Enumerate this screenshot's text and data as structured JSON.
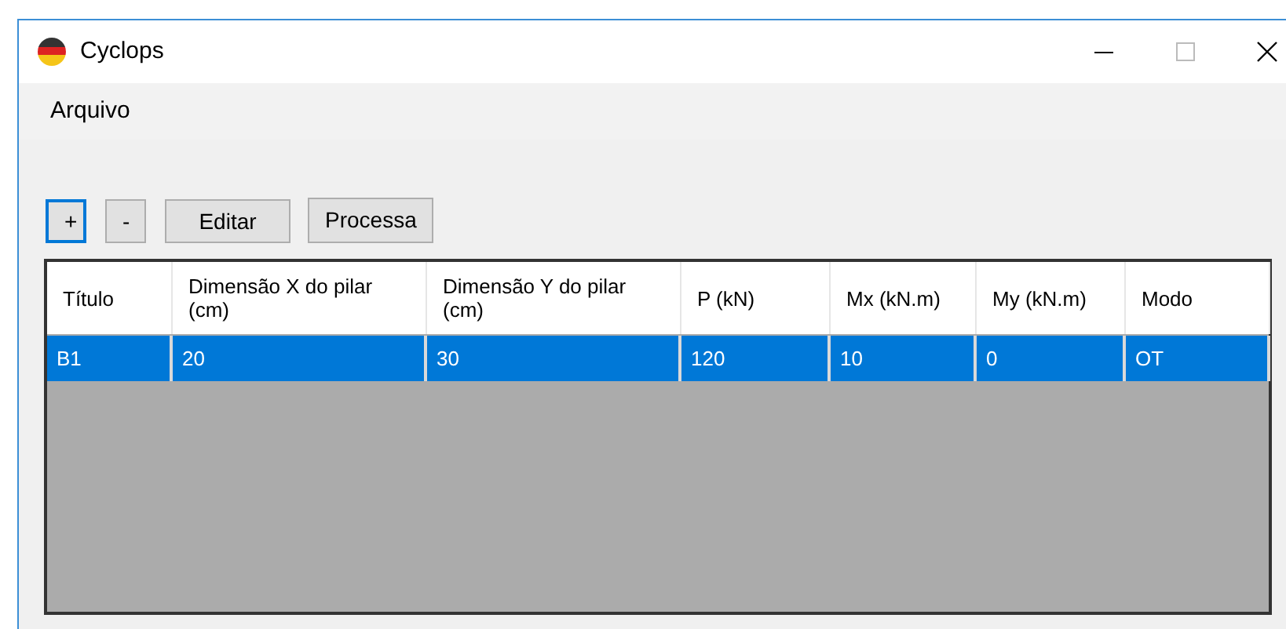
{
  "window": {
    "title": "Cyclops"
  },
  "menu": [
    "Arquivo"
  ],
  "buttons": [
    {
      "label": "+",
      "focused": true
    },
    {
      "label": "-",
      "focused": false
    },
    {
      "label": "Editar",
      "focused": false
    },
    {
      "label": "Processa",
      "focused": false
    }
  ],
  "table": {
    "columns": [
      "Título",
      "Dimensão X do pilar (cm)",
      "Dimensão Y do pilar (cm)",
      "P (kN)",
      "Mx (kN.m)",
      "My (kN.m)",
      "Modo"
    ],
    "rows": [
      {
        "cells": [
          "B1",
          "20",
          "30",
          "120",
          "10",
          "0",
          "OT"
        ],
        "selected": true
      }
    ]
  }
}
